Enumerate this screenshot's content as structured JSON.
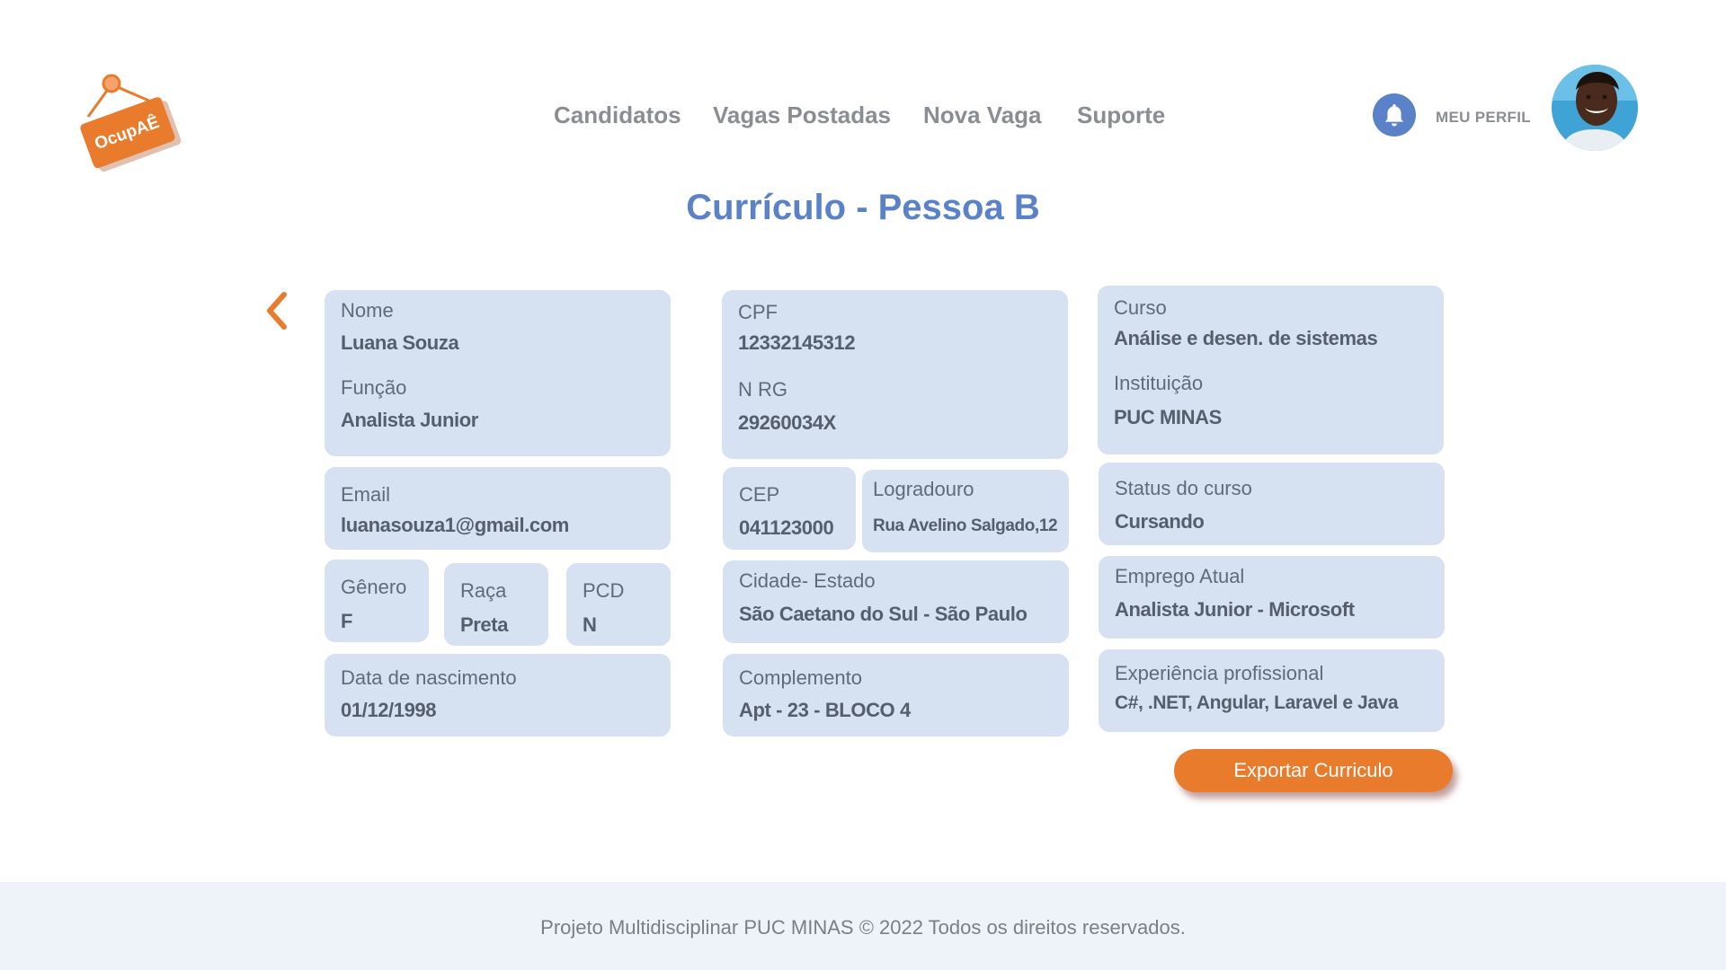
{
  "logo": {
    "text": "OcupAÊ",
    "color": "#e97b2d"
  },
  "nav": {
    "items": [
      {
        "label": "Candidatos"
      },
      {
        "label": "Vagas Postadas"
      },
      {
        "label": "Nova Vaga"
      },
      {
        "label": "Suporte"
      }
    ]
  },
  "header": {
    "profile_label": "MEU PERFIL",
    "bell_icon": "bell-icon",
    "accent": "#5b82c9"
  },
  "page": {
    "title": "Currículo - Pessoa B"
  },
  "cards": {
    "nome": {
      "label": "Nome",
      "value": "Luana Souza"
    },
    "funcao": {
      "label": "Função",
      "value": "Analista Junior"
    },
    "email": {
      "label": "Email",
      "value": "luanasouza1@gmail.com"
    },
    "genero": {
      "label": "Gênero",
      "value": "F"
    },
    "raca": {
      "label": "Raça",
      "value": "Preta"
    },
    "pcd": {
      "label": "PCD",
      "value": "N"
    },
    "nascimento": {
      "label": "Data de nascimento",
      "value": "01/12/1998"
    },
    "cpf": {
      "label": "CPF",
      "value": "12332145312"
    },
    "rg": {
      "label": "N RG",
      "value": "29260034X"
    },
    "cep": {
      "label": "CEP",
      "value": "041123000"
    },
    "logradouro": {
      "label": "Logradouro",
      "value": "Rua Avelino Salgado,12"
    },
    "cidade": {
      "label": "Cidade- Estado",
      "value": "São Caetano do Sul - São Paulo"
    },
    "complemento": {
      "label": "Complemento",
      "value": "Apt - 23 - BLOCO 4"
    },
    "curso": {
      "label": "Curso",
      "value": "Análise e desen. de sistemas"
    },
    "instituicao": {
      "label": "Instituição",
      "value": "PUC MINAS"
    },
    "status": {
      "label": "Status do curso",
      "value": "Cursando"
    },
    "emprego": {
      "label": "Emprego Atual",
      "value": "Analista Junior - Microsoft"
    },
    "experiencia": {
      "label": "Experiência profissional",
      "value": "C#, .NET, Angular, Laravel e Java"
    }
  },
  "actions": {
    "export_label": "Exportar Curriculo",
    "export_color": "#e97b2d"
  },
  "footer": {
    "text": "Projeto Multidisciplinar  PUC MINAS © 2022 Todos os direitos reservados."
  }
}
